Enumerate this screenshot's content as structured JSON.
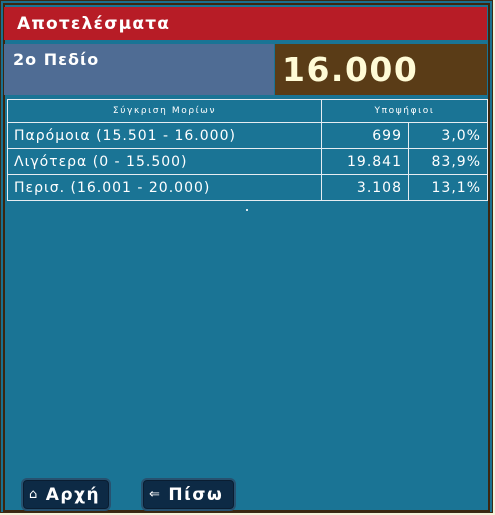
{
  "header": {
    "title": "Αποτελέσματα"
  },
  "field": {
    "label": "2ο Πεδίο",
    "score": "16.000"
  },
  "table": {
    "columns": [
      "Σύγκριση Μορίων",
      "Υποψήφιοι"
    ],
    "rows": [
      {
        "label": "Παρόμοια (15.501 - 16.000)",
        "count": "699",
        "percent": "3,0%"
      },
      {
        "label": "Λιγότερα (0 - 15.500)",
        "count": "19.841",
        "percent": "83,9%"
      },
      {
        "label": "Περισ. (16.001 - 20.000)",
        "count": "3.108",
        "percent": "13,1%"
      }
    ]
  },
  "nav": {
    "home_icon": "⌂",
    "home_label": "Αρχή",
    "back_icon": "⇐",
    "back_label": "Πίσω"
  },
  "colors": {
    "header_bg": "#b71c26",
    "panel_bg": "#1a7495",
    "score_bg": "#5a3c17",
    "field_bg": "#4f6c94"
  }
}
